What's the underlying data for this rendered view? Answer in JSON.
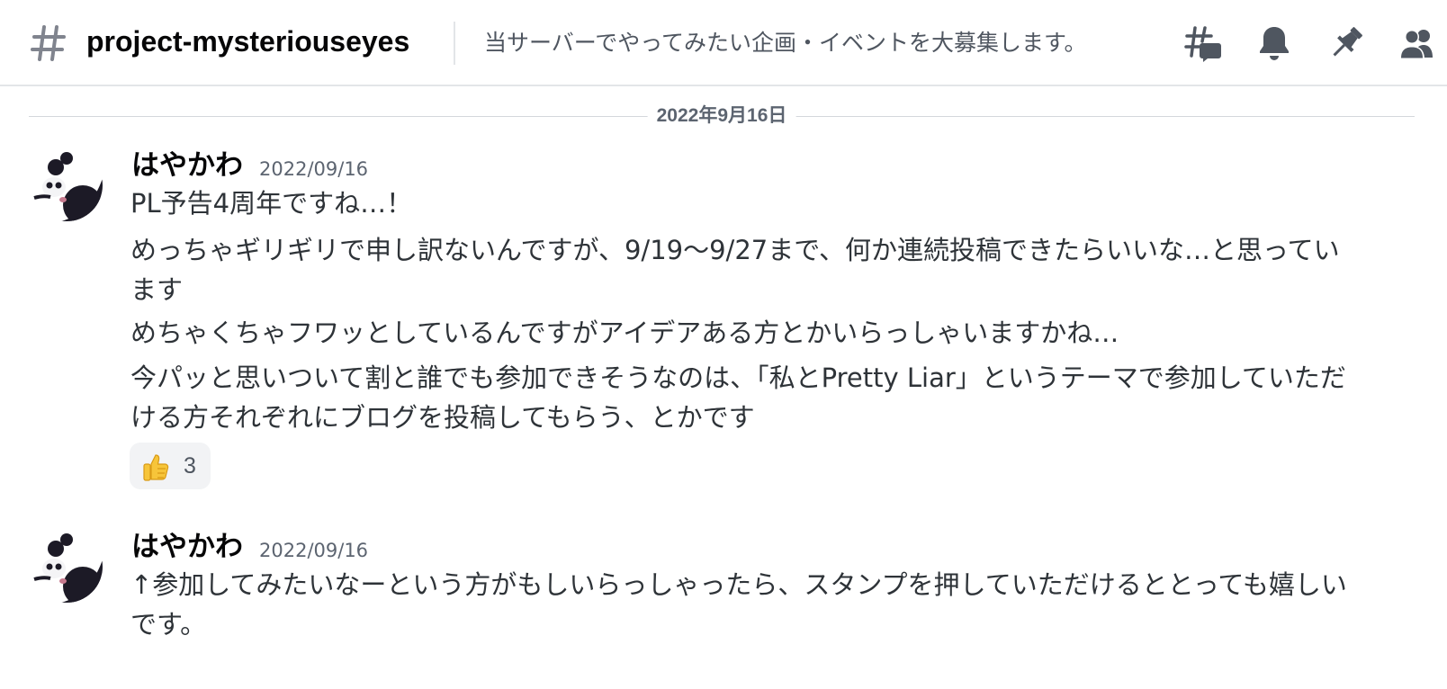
{
  "header": {
    "channel_name": "project-mysteriouseyes",
    "topic": "当サーバーでやってみたい企画・イベントを大募集します。",
    "icons": [
      "hash-icon",
      "threads-icon",
      "bell-icon",
      "pin-icon",
      "members-icon"
    ]
  },
  "date_divider": "2022年9月16日",
  "messages": [
    {
      "author": "はやかわ",
      "timestamp": "2022/09/16",
      "lines": [
        "PL予告4周年ですね…！",
        "めっちゃギリギリで申し訳ないんですが、9/19〜9/27まで、何か連続投稿できたらいいな…と思っています",
        "めちゃくちゃフワッとしているんですがアイデアある方とかいらっしゃいますかね…",
        "今パッと思いついて割と誰でも参加できそうなのは、「私とPretty Liar」というテーマで参加していただける方それぞれにブログを投稿してもらう、とかです"
      ],
      "reaction": {
        "emoji": "thumbs-up-icon",
        "count": "3"
      }
    },
    {
      "author": "はやかわ",
      "timestamp": "2022/09/16",
      "lines": [
        "↑参加してみたいなーという方がもしいらっしゃったら、スタンプを押していただけるととっても嬉しいです。"
      ]
    }
  ],
  "colors": {
    "text_primary": "#060607",
    "text_body": "#2e3338",
    "text_muted": "#5c6470",
    "divider": "#e3e5e8",
    "reaction_bg": "#f2f3f5"
  }
}
